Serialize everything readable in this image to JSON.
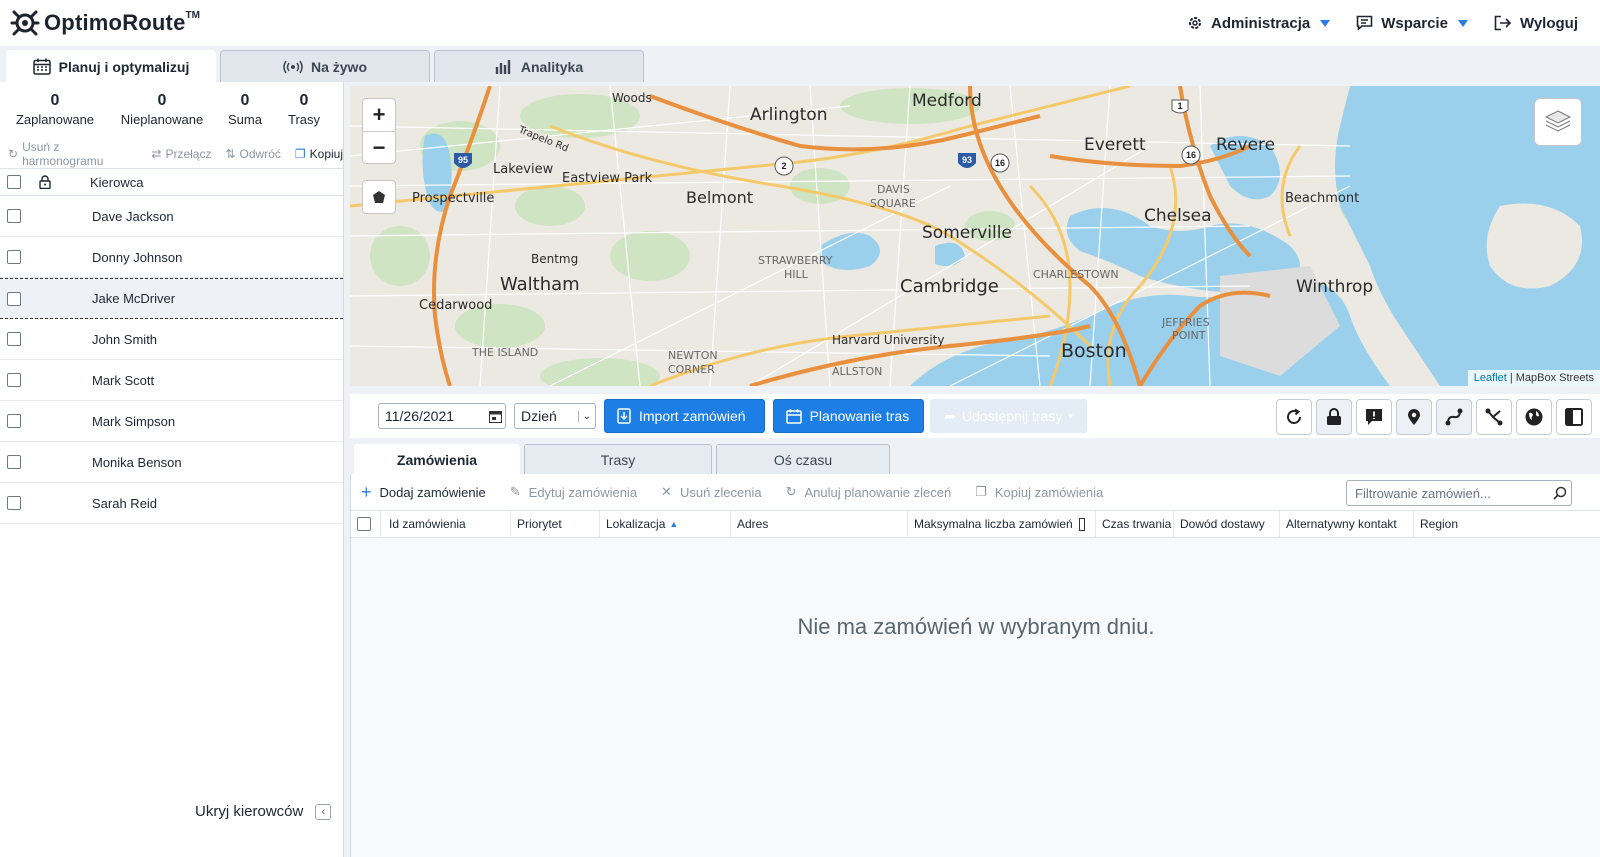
{
  "header": {
    "brand": "OptimoRoute",
    "brand_tm": "TM",
    "admin": "Administracja",
    "support": "Wsparcie",
    "logout": "Wyloguj",
    "accent": "#2a7de1"
  },
  "main_tabs": [
    {
      "label": "Planuj i optymalizuj",
      "icon": "calendar-icon"
    },
    {
      "label": "Na żywo",
      "icon": "broadcast-icon"
    },
    {
      "label": "Analityka",
      "icon": "bar-chart-icon"
    }
  ],
  "stats": [
    {
      "value": "0",
      "label": "Zaplanowane"
    },
    {
      "value": "0",
      "label": "Nieplanowane"
    },
    {
      "value": "0",
      "label": "Suma"
    },
    {
      "value": "0",
      "label": "Trasy"
    }
  ],
  "left_tools": {
    "unschedule": "Usuń z harmonogramu",
    "switch": "Przełącz",
    "reverse": "Odwróć",
    "copy": "Kopiuj"
  },
  "drivers": {
    "column": "Kierowca",
    "rows": [
      "Dave Jackson",
      "Donny Johnson",
      "Jake McDriver",
      "John Smith",
      "Mark Scott",
      "Mark Simpson",
      "Monika Benson",
      "Sarah Reid"
    ],
    "hide_label": "Ukryj kierowców"
  },
  "map": {
    "attribution_link": "Leaflet",
    "attribution_text": "| MapBox Streets",
    "labels": {
      "arlington": "Arlington",
      "medford": "Medford",
      "everett": "Everett",
      "revere": "Revere",
      "lakeview": "Lakeview",
      "eastview": "Eastview Park",
      "belmont": "Belmont",
      "davis": "DAVIS",
      "square": "SQUARE",
      "prospectville": "Prospectville",
      "somerville": "Somerville",
      "chelsea": "Chelsea",
      "beachmont": "Beachmont",
      "bentmg": "Bentmg",
      "strawberry": "STRAWBERRY",
      "hill": "HILL",
      "waltham": "Waltham",
      "cambridge": "Cambridge",
      "charlestown": "CHARLESTOWN",
      "winthrop": "Winthrop",
      "cedarwood": "Cedarwood",
      "jeffries": "JEFFRIES",
      "point": "POINT",
      "harvard": "Harvard University",
      "island": "THE ISLAND",
      "newton": "NEWTON",
      "corner": "CORNER",
      "allston": "ALLSTON",
      "boston": "Boston",
      "woods": "Woods",
      "trapelo": "Trapelo Rd"
    },
    "shields": {
      "i95a": "95",
      "i93": "93",
      "r2": "2",
      "r16a": "16",
      "r16b": "16",
      "r1": "1"
    }
  },
  "toolbar": {
    "date": "11/26/2021",
    "period": "Dzień",
    "import": "Import zamówień",
    "plan": "Planowanie tras",
    "share": "Udostępnij trasy"
  },
  "sub_tabs": [
    "Zamówienia",
    "Trasy",
    "Oś czasu"
  ],
  "order_tools": {
    "add": "Dodaj zamówienie",
    "edit": "Edytuj zamówienia",
    "delete": "Usuń zlecenia",
    "cancel": "Anuluj planowanie zleceń",
    "copy": "Kopiuj zamówienia",
    "filter_placeholder": "Filtrowanie zamówień..."
  },
  "columns": [
    "Id zamówienia",
    "Priorytet",
    "Lokalizacja",
    "Adres",
    "Maksymalna liczba zamówień",
    "Czas trwania",
    "Dowód dostawy",
    "Alternatywny kontakt",
    "Region"
  ],
  "empty_message": "Nie ma zamówień w wybranym dniu."
}
